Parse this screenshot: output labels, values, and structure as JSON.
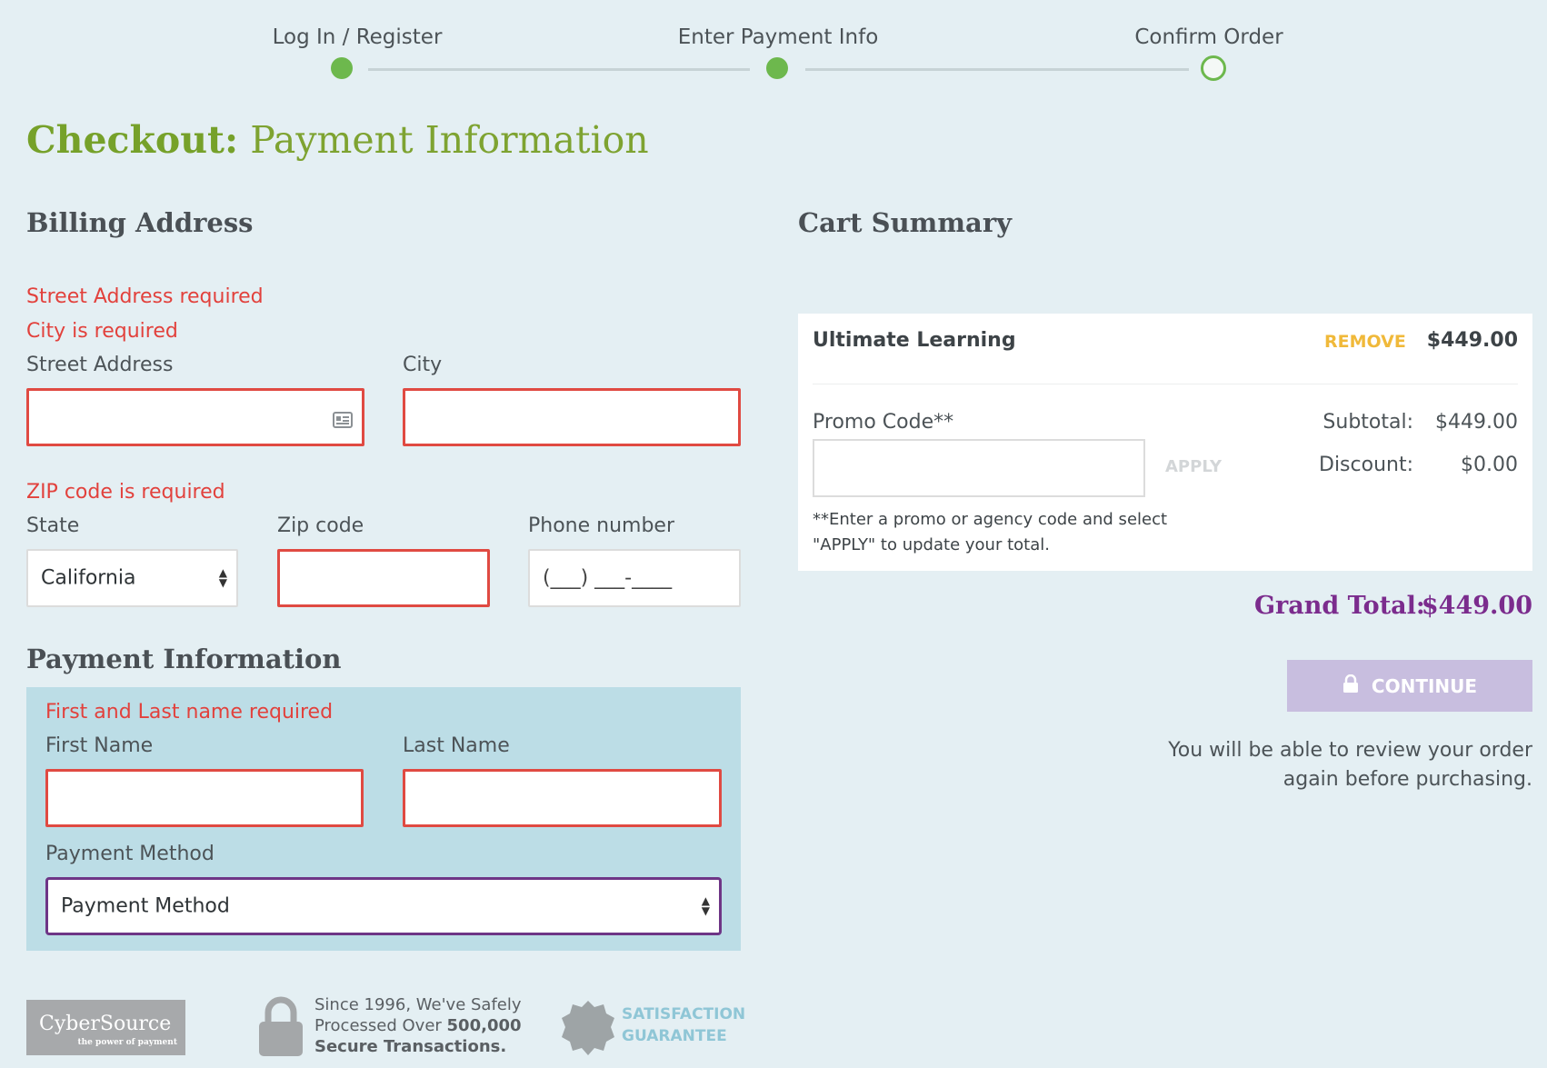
{
  "progress": {
    "steps": [
      {
        "label": "Log In / Register",
        "state": "complete"
      },
      {
        "label": "Enter Payment Info",
        "state": "complete"
      },
      {
        "label": "Confirm Order",
        "state": "current"
      }
    ],
    "accent_color": "#6db84d"
  },
  "page_title": {
    "bold": "Checkout:",
    "rest": "Payment Information"
  },
  "billing": {
    "heading": "Billing Address",
    "errors": {
      "street": "Street Address required",
      "city": "City is required",
      "zip": "ZIP code is required"
    },
    "street_label": "Street Address",
    "street_value": "",
    "city_label": "City",
    "city_value": "",
    "state_label": "State",
    "state_value": "California",
    "zip_label": "Zip code",
    "zip_value": "",
    "phone_label": "Phone number",
    "phone_placeholder": "(___) ___-____"
  },
  "payment": {
    "heading": "Payment Information",
    "error": "First and Last name required",
    "first_label": "First Name",
    "last_label": "Last Name",
    "method_label": "Payment Method",
    "method_value": "Payment Method"
  },
  "cart": {
    "heading": "Cart Summary",
    "item_name": "Ultimate Learning",
    "remove_label": "REMOVE",
    "item_price": "$449.00",
    "promo_label": "Promo Code**",
    "apply_label": "APPLY",
    "promo_note_line1": "**Enter a promo or agency code and select",
    "promo_note_line2": "\"APPLY\" to update your total.",
    "subtotal_label": "Subtotal:",
    "subtotal_value": "$449.00",
    "discount_label": "Discount:",
    "discount_value": "$0.00",
    "grand_label": "Grand Total:",
    "grand_value": "$449.00",
    "continue_label": "CONTINUE",
    "review_line1": "You will be able to review your order",
    "review_line2": "again before purchasing."
  },
  "trust": {
    "cybersource": "CyberSource",
    "cybersource_tagline": "the power of payment",
    "since_line1": "Since 1996, We've Safely",
    "since_line2_pre": "Processed Over ",
    "since_line2_bold": "500,000",
    "since_line3": "Secure Transactions.",
    "guarantee_line1": "SATISFACTION",
    "guarantee_line2": "GUARANTEE"
  },
  "colors": {
    "error": "#e2413c",
    "brand_green": "#76a12a",
    "purple": "#7b2c8d",
    "remove_yellow": "#f0b93a"
  }
}
